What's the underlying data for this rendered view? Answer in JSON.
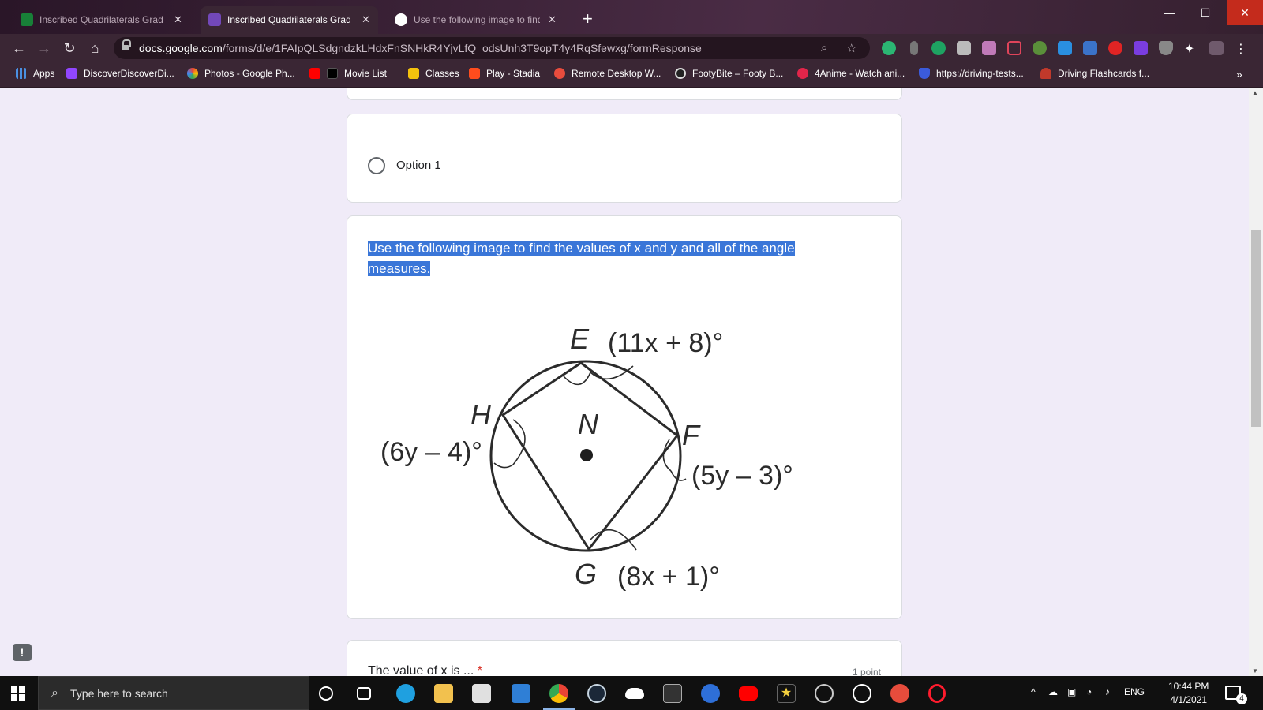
{
  "browser": {
    "tabs": [
      {
        "title": "Inscribed Quadrilaterals Grad",
        "active": false
      },
      {
        "title": "Inscribed Quadrilaterals Grad",
        "active": true
      },
      {
        "title": "Use the following image to find",
        "active": false
      }
    ],
    "url_host": "docs.google.com",
    "url_path": "/forms/d/e/1FAIpQLSdgndzkLHdxFnSNHkR4YjvLfQ_odsUnh3T9opT4y4RqSfewxg/formResponse",
    "bookmarks": [
      "Apps",
      "DiscoverDiscoverDi...",
      "Photos - Google Ph...",
      "Movie List",
      "Classes",
      "Play - Stadia",
      "Remote Desktop W...",
      "FootyBite – Footy B...",
      "4Anime - Watch ani...",
      "https://driving-tests...",
      "Driving Flashcards f..."
    ]
  },
  "form": {
    "option_label": "Option 1",
    "question_line1": "Use the following image to find the values of x and y and all of the angle",
    "question_line2": "measures.",
    "diagram": {
      "E": "E",
      "F": "F",
      "G": "G",
      "H": "H",
      "N": "N",
      "angle_E": "(11x + 8)°",
      "angle_F": "(5y – 3)°",
      "angle_G": "(8x + 1)°",
      "angle_H": "(6y – 4)°"
    },
    "next_question": "The value of x is ...",
    "required_mark": "*",
    "points": "1 point"
  },
  "taskbar": {
    "search_placeholder": "Type here to search",
    "language": "ENG",
    "time": "10:44 PM",
    "date": "4/1/2021",
    "notifications": "4"
  }
}
